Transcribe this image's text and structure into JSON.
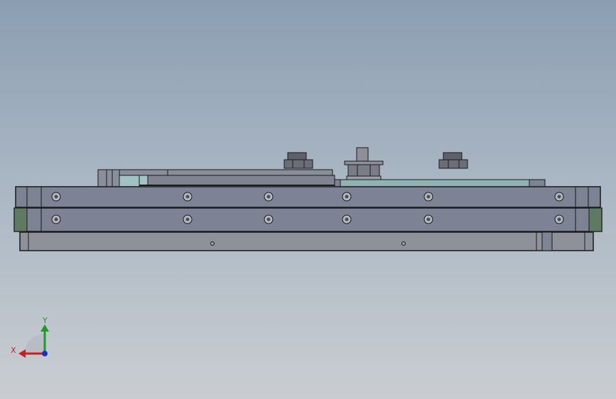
{
  "scene": {
    "view": "front",
    "background_top": "#8c9eb2",
    "background_bottom": "#c9cdd1",
    "part_fill": "#7d8294",
    "part_edge": "#1a1a1a",
    "accent_green": "#5f7a62",
    "accent_cyan": "#8fb3b3"
  },
  "triad": {
    "x_label": "X",
    "y_label": "Y",
    "x_color": "#d01c1c",
    "y_color": "#1f9a2a",
    "z_color": "#1a2fd0"
  }
}
